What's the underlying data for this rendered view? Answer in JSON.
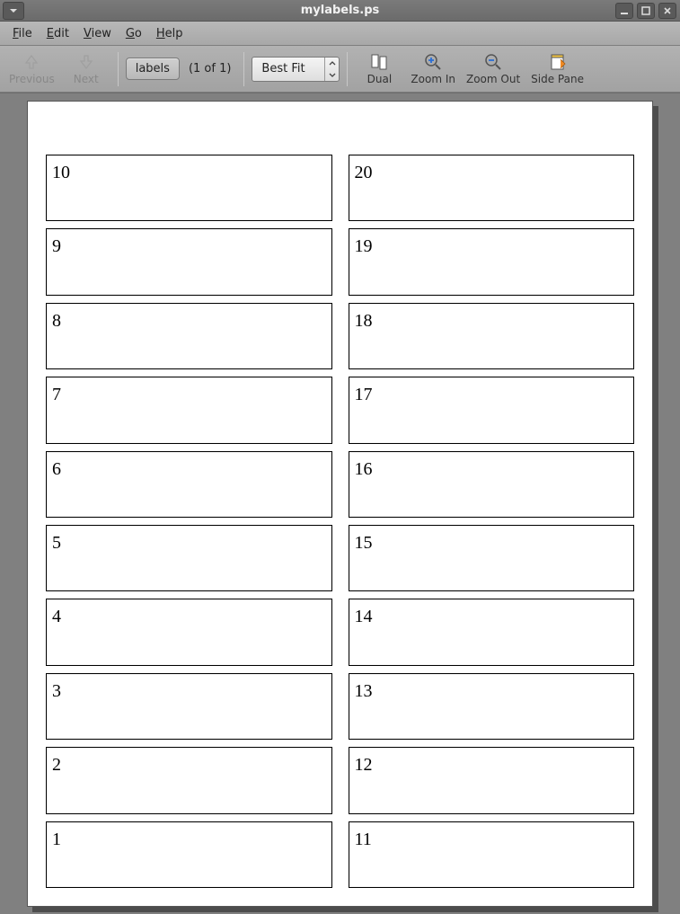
{
  "window": {
    "title": "mylabels.ps"
  },
  "menu": {
    "file": "File",
    "edit": "Edit",
    "view": "View",
    "go": "Go",
    "help": "Help"
  },
  "toolbar": {
    "previous": "Previous",
    "next": "Next",
    "tag_label": "labels",
    "page_of": "(1 of 1)",
    "zoom_mode": "Best Fit",
    "dual": "Dual",
    "zoom_in": "Zoom In",
    "zoom_out": "Zoom Out",
    "side_pane": "Side Pane"
  },
  "document": {
    "left_column": [
      "10",
      "9",
      "8",
      "7",
      "6",
      "5",
      "4",
      "3",
      "2",
      "1"
    ],
    "right_column": [
      "20",
      "19",
      "18",
      "17",
      "16",
      "15",
      "14",
      "13",
      "12",
      "11"
    ]
  }
}
